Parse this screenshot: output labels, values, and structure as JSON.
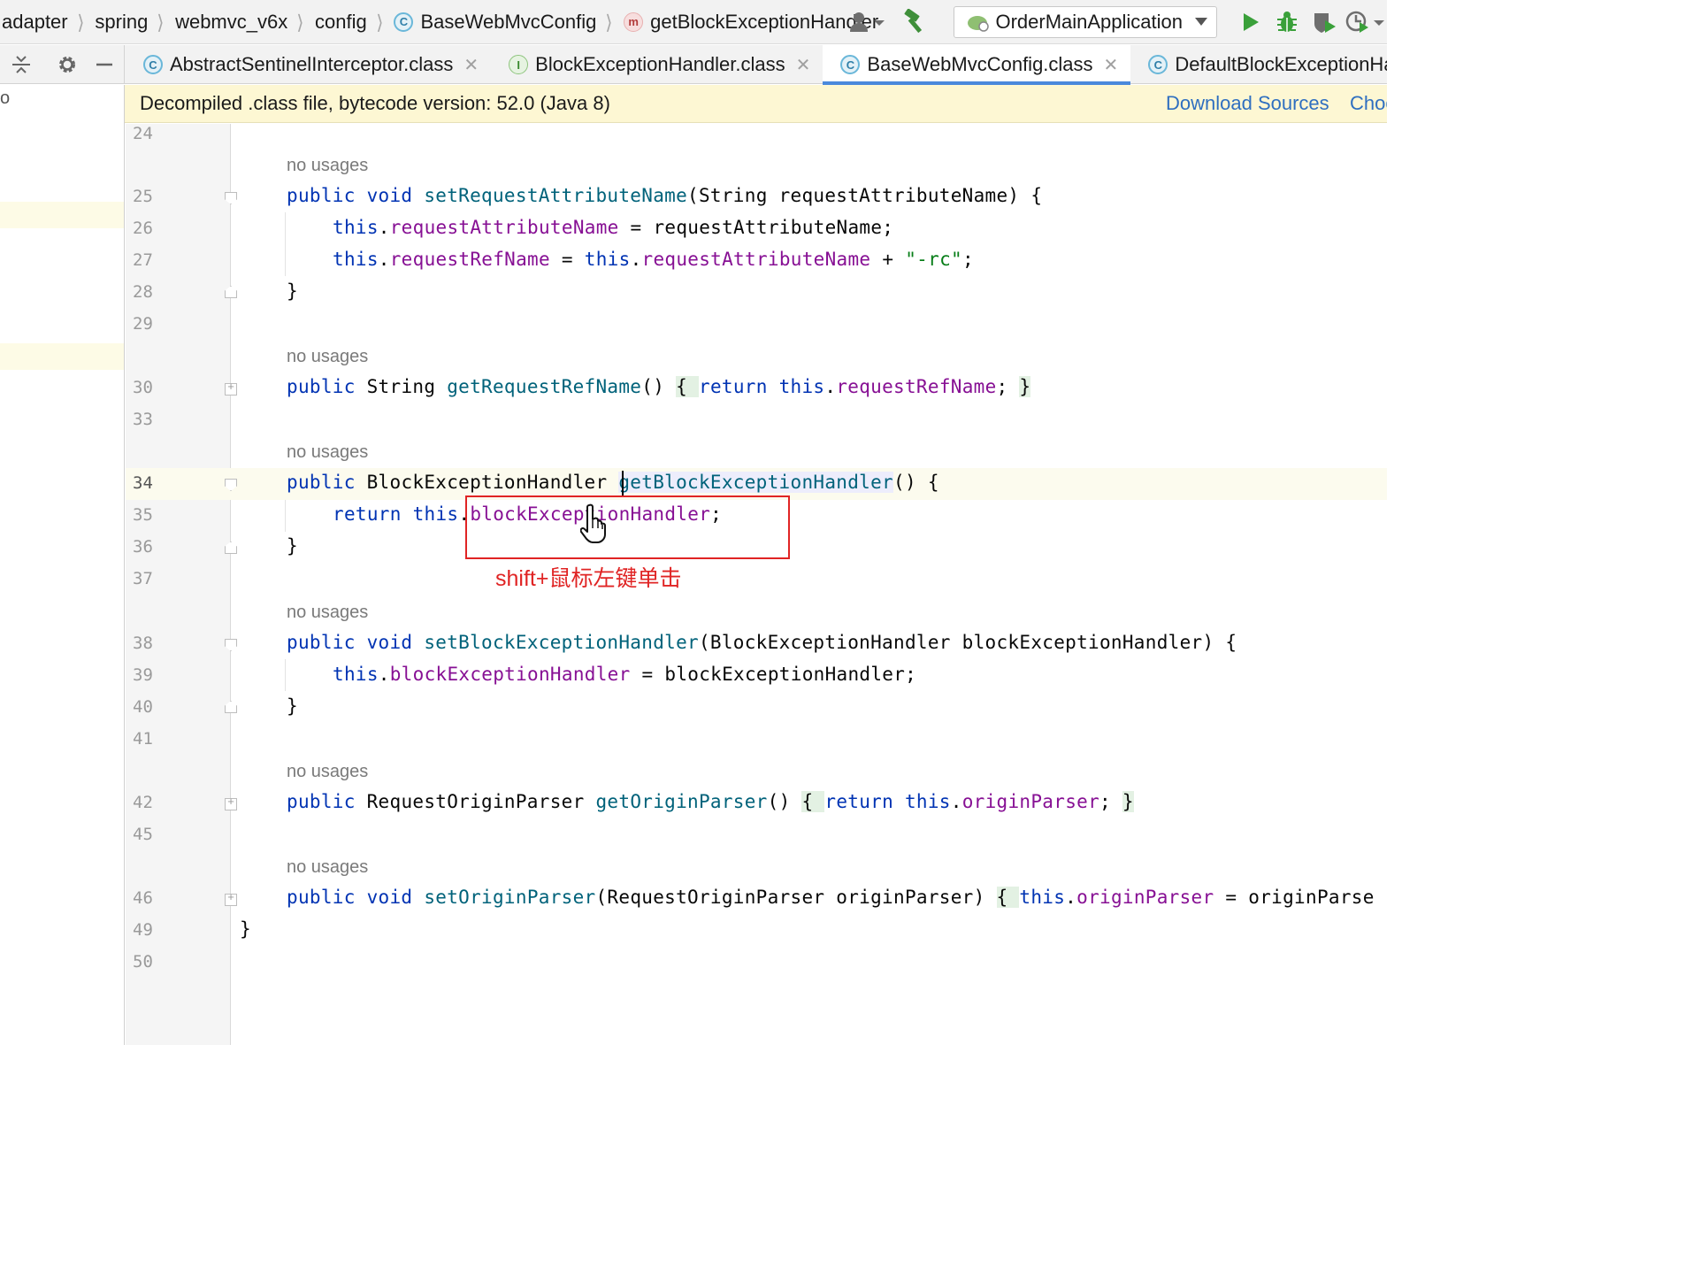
{
  "breadcrumb": {
    "items": [
      "adapter",
      "spring",
      "webmvc_v6x",
      "config",
      "BaseWebMvcConfig",
      "getBlockExceptionHandler"
    ]
  },
  "toolbar": {
    "run_config": "OrderMainApplication"
  },
  "tabs": [
    {
      "label": "AbstractSentinelInterceptor.class",
      "icon": "class-icon",
      "active": false
    },
    {
      "label": "BlockExceptionHandler.class",
      "icon": "interface-icon",
      "active": false
    },
    {
      "label": "BaseWebMvcConfig.class",
      "icon": "class-icon",
      "active": true
    },
    {
      "label": "DefaultBlockExceptionHandler.cla",
      "icon": "class-icon",
      "active": false
    }
  ],
  "banner": {
    "text": "Decompiled .class file, bytecode version: 52.0 (Java 8)",
    "download_link": "Download Sources",
    "choose_link": "Choo"
  },
  "left_panel": {
    "text": "o"
  },
  "editor": {
    "line_numbers": [
      "24",
      "25",
      "26",
      "27",
      "28",
      "29",
      "30",
      "33",
      "34",
      "35",
      "36",
      "37",
      "38",
      "39",
      "40",
      "41",
      "42",
      "45",
      "46",
      "49",
      "50"
    ],
    "usage_hint": "no usages",
    "lines": {
      "l25": {
        "t1": "public void ",
        "t2": "setRequestAttributeName",
        "t3": "(String requestAttributeName) {"
      },
      "l26": {
        "t1": "this",
        "t2": ".",
        "t3": "requestAttributeName",
        "t4": " = requestAttributeName;"
      },
      "l27": {
        "t1": "this",
        "t2": ".",
        "t3": "requestRefName",
        "t4": " = ",
        "t5": "this",
        "t6": ".",
        "t7": "requestAttributeName",
        "t8": " + ",
        "t9": "\"-rc\"",
        "t10": ";"
      },
      "l28": {
        "t1": "}"
      },
      "l30": {
        "t1": "public ",
        "t2": "String ",
        "t3": "getRequestRefName",
        "t4": "() ",
        "t5": "{ ",
        "t6": "return this",
        "t7": ".",
        "t8": "requestRefName",
        "t9": "; ",
        "t10": "}"
      },
      "l34": {
        "t1": "public ",
        "t2": "BlockExceptionHandler ",
        "t3": "getBlockExceptionHandler",
        "t4": "() {"
      },
      "l35": {
        "t1": "return this",
        "t2": ".",
        "t3": "blockExceptionHandler",
        "t4": ";"
      },
      "l36": {
        "t1": "}"
      },
      "l38": {
        "t1": "public void ",
        "t2": "setBlockExceptionHandler",
        "t3": "(BlockExceptionHandler blockExceptionHandler) {"
      },
      "l39": {
        "t1": "this",
        "t2": ".",
        "t3": "blockExceptionHandler",
        "t4": " = blockExceptionHandler;"
      },
      "l40": {
        "t1": "}"
      },
      "l42": {
        "t1": "public ",
        "t2": "RequestOriginParser ",
        "t3": "getOriginParser",
        "t4": "() ",
        "t5": "{ ",
        "t6": "return this",
        "t7": ".",
        "t8": "originParser",
        "t9": "; ",
        "t10": "}"
      },
      "l46": {
        "t1": "public void ",
        "t2": "setOriginParser",
        "t3": "(RequestOriginParser originParser) ",
        "t4": "{ ",
        "t5": "this",
        "t6": ".",
        "t7": "originParser",
        "t8": " = originParse"
      },
      "l49": {
        "t1": "}"
      }
    }
  },
  "annotation": {
    "text": "shift+鼠标左键单击",
    "color": "#e02424"
  },
  "colors": {
    "keyword": "#0033b3",
    "method": "#00627a",
    "field": "#871094",
    "string": "#067d17",
    "active_tab_underline": "#4a89dc",
    "banner_bg": "#fdf7d3"
  }
}
